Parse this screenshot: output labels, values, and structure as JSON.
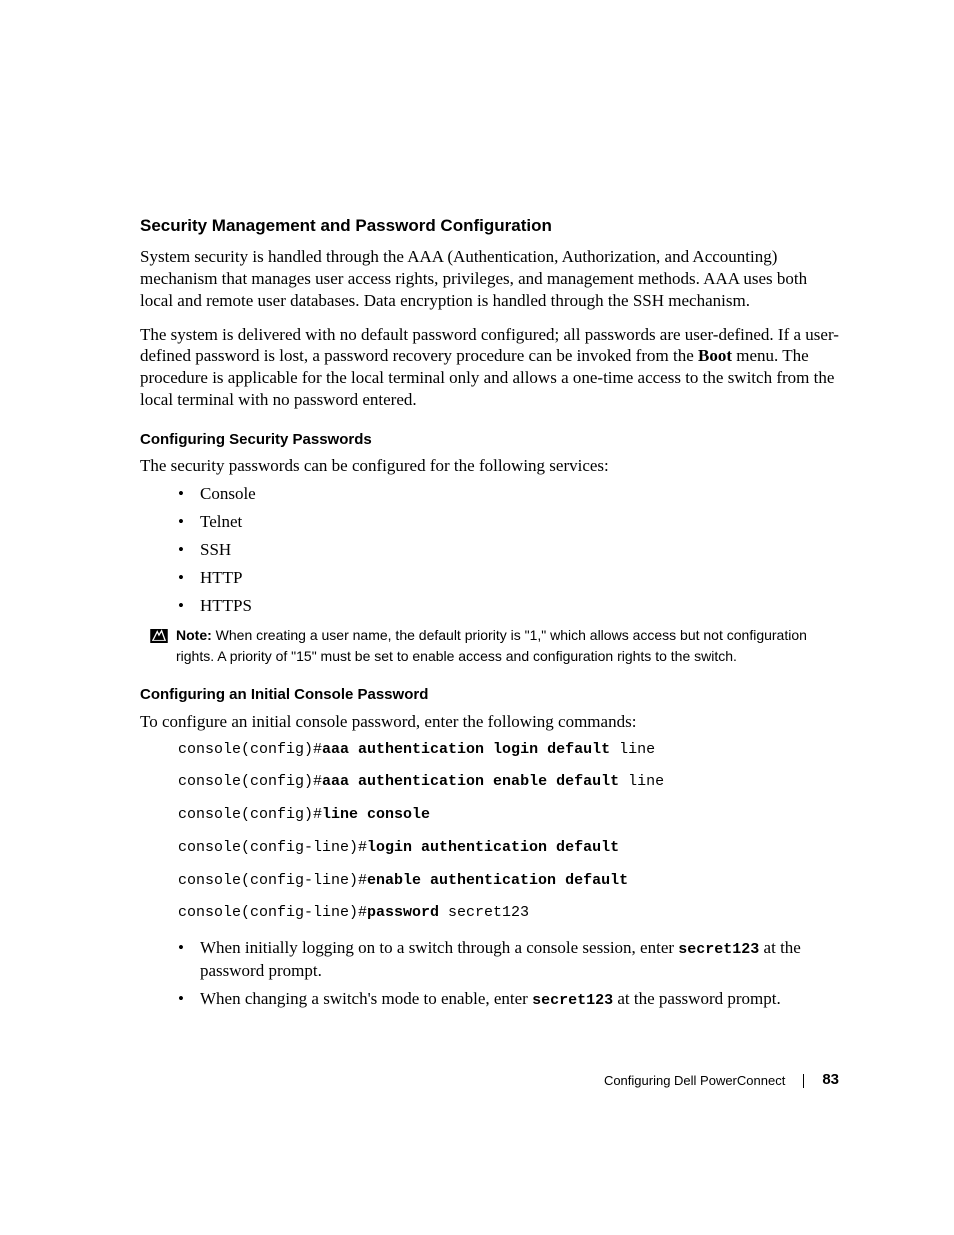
{
  "heading": "Security Management and Password Configuration",
  "para1_a": "System security is handled through the AAA (Authentication, Authorization, and Accounting) mechanism that manages user access rights, privileges, and management methods. AAA uses both local and remote user databases. Data encryption is handled through the SSH mechanism.",
  "para2_a": "The system is delivered with no default password configured; all passwords are user-defined. If a user-defined password is lost, a password recovery procedure can be invoked from the ",
  "para2_bold": "Boot",
  "para2_b": " menu. The procedure is applicable for the local terminal only and allows a one-time access to the switch from the local terminal with no password entered.",
  "sub1": "Configuring Security Passwords",
  "sub1_intro": "The security passwords can be configured for the following services:",
  "services": [
    "Console",
    "Telnet",
    "SSH",
    "HTTP",
    "HTTPS"
  ],
  "note_label": "Note:",
  "note_body": " When creating a user name, the default priority is \"1,\" which allows access but not configuration rights. A priority of \"15\" must be set to enable access and configuration rights to the switch.",
  "sub2": "Configuring an Initial Console Password",
  "sub2_intro": "To configure an initial console password, enter the following commands:",
  "cmds": [
    {
      "pre": "console(config)#",
      "bold": "aaa authentication login default",
      "post": " line"
    },
    {
      "pre": "console(config)#",
      "bold": "aaa authentication enable default",
      "post": " line"
    },
    {
      "pre": "console(config)#",
      "bold": "line console",
      "post": ""
    },
    {
      "pre": "console(config-line)#",
      "bold": "login authentication default",
      "post": ""
    },
    {
      "pre": "console(config-line)#",
      "bold": "enable authentication default",
      "post": ""
    },
    {
      "pre": "console(config-line)#",
      "bold": "password",
      "post": " secret123"
    }
  ],
  "bottom1_a": "When initially logging on to a switch through a console session, enter ",
  "bottom1_code": "secret123",
  "bottom1_b": " at the password prompt.",
  "bottom2_a": "When changing a switch's mode to enable, enter ",
  "bottom2_code": "secret123",
  "bottom2_b": " at the password prompt.",
  "footer_text": "Configuring Dell PowerConnect",
  "page_number": "83"
}
